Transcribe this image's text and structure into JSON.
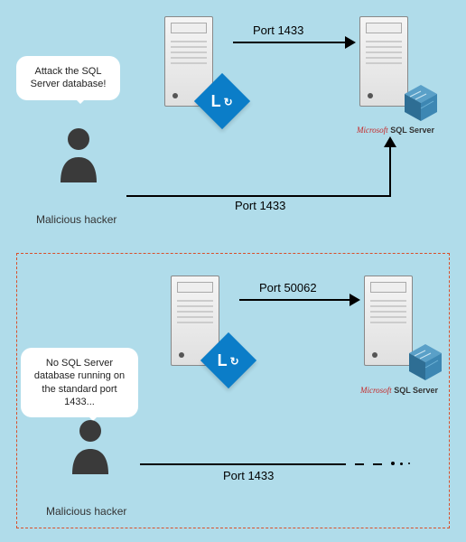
{
  "top": {
    "speech": "Attack the SQL Server database!",
    "hacker_label": "Malicious hacker",
    "lync_letter": "L",
    "port_top": "Port 1433",
    "port_bottom": "Port 1433",
    "sql_prefix": "Microsoft",
    "sql_name": "SQL Server"
  },
  "bottom": {
    "speech": "No SQL Server database running on the standard port 1433...",
    "hacker_label": "Malicious hacker",
    "lync_letter": "L",
    "port_top": "Port 50062",
    "port_bottom": "Port 1433",
    "sql_prefix": "Microsoft",
    "sql_name": "SQL Server"
  }
}
